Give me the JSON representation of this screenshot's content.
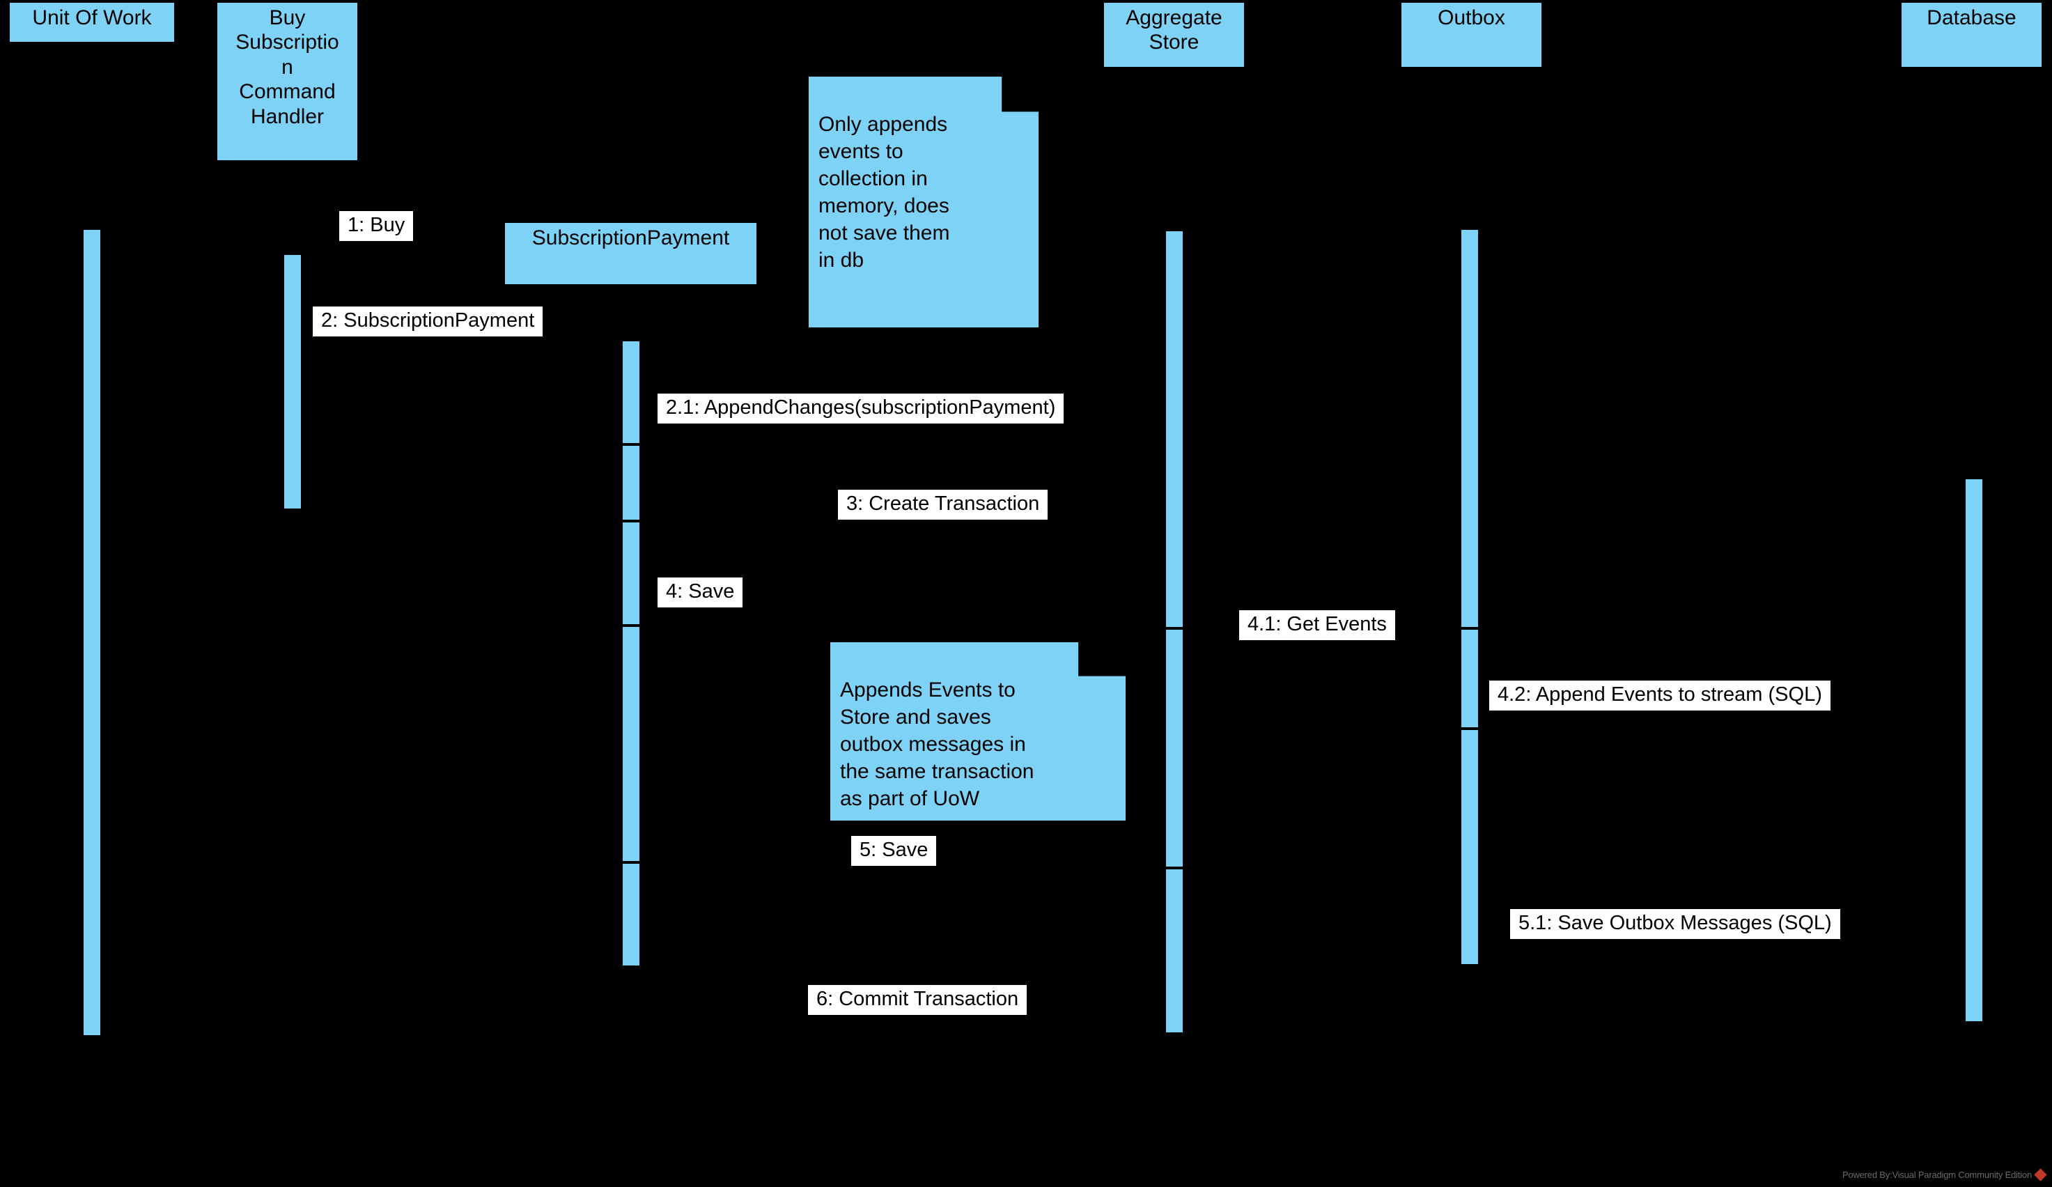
{
  "diagram": {
    "type": "uml-sequence-diagram",
    "background_color": "#000000",
    "accent_color": "#7DD2F5",
    "label_bg_color": "#FFFFFF",
    "stroke_color": "#000000"
  },
  "lifelines": [
    {
      "id": "unit-of-work",
      "label": "Unit Of Work"
    },
    {
      "id": "buy-subscription-command-handler",
      "label": "Buy\nSubscriptio\nn\nCommand\nHandler"
    },
    {
      "id": "subscription-payment",
      "label": "SubscriptionPayment"
    },
    {
      "id": "aggregate-store",
      "label": "Aggregate\nStore"
    },
    {
      "id": "outbox",
      "label": "Outbox"
    },
    {
      "id": "database",
      "label": "Database"
    }
  ],
  "messages": [
    {
      "id": "m1",
      "label": "1: Buy"
    },
    {
      "id": "m2",
      "label": "2: SubscriptionPayment"
    },
    {
      "id": "m2_1",
      "label": "2.1: AppendChanges(subscriptionPayment)"
    },
    {
      "id": "m3",
      "label": "3: Create Transaction"
    },
    {
      "id": "m4",
      "label": "4: Save"
    },
    {
      "id": "m4_1",
      "label": "4.1: Get Events"
    },
    {
      "id": "m4_2",
      "label": "4.2: Append Events to stream (SQL)"
    },
    {
      "id": "m5",
      "label": "5: Save"
    },
    {
      "id": "m5_1",
      "label": "5.1: Save Outbox Messages (SQL)"
    },
    {
      "id": "m6",
      "label": "6: Commit Transaction"
    }
  ],
  "notes": [
    {
      "id": "note-memory-append",
      "text": "Only appends\nevents to\ncollection in\nmemory, does\nnot save them\nin db"
    },
    {
      "id": "note-same-transaction",
      "text": "Appends Events to\nStore and saves\noutbox messages in\nthe same transaction\nas part of UoW"
    }
  ],
  "watermark": {
    "text": "Powered By:Visual Paradigm Community Edition"
  }
}
